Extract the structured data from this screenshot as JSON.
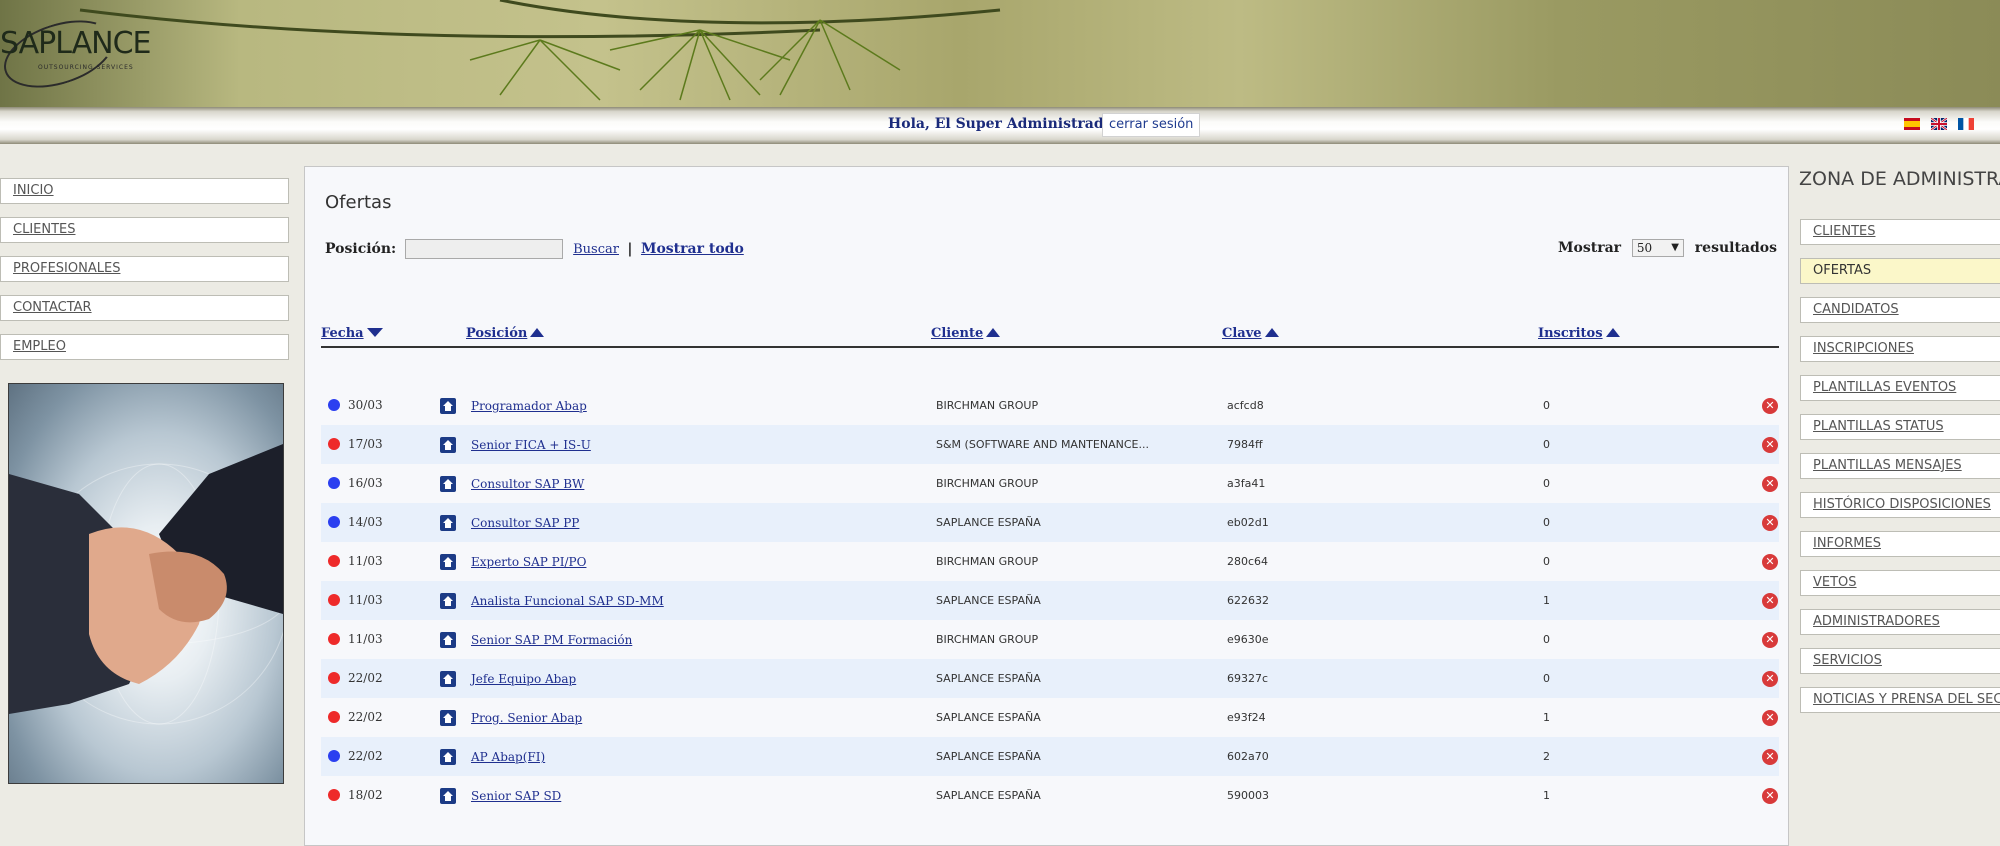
{
  "header": {
    "logo_text": "SAPLANCE",
    "logo_sub": "OUTSOURCING SERVICES"
  },
  "topbar": {
    "greeting": "Hola, El Super Administrador",
    "logout": "cerrar sesión",
    "flags": [
      "es-flag-icon",
      "uk-flag-icon",
      "fr-flag-icon"
    ]
  },
  "leftnav": {
    "items": [
      "INICIO",
      "CLIENTES",
      "PROFESIONALES",
      "CONTACTAR",
      "EMPLEO"
    ]
  },
  "main": {
    "title": "Ofertas",
    "search_label": "Posición:",
    "search_value": "",
    "search_button": "Buscar",
    "separator": "|",
    "show_all": "Mostrar todo",
    "show_label": "Mostrar",
    "show_value": "50",
    "show_suffix": "resultados",
    "columns": {
      "fecha": "Fecha",
      "posicion": "Posición",
      "cliente": "Cliente",
      "clave": "Clave",
      "inscritos": "Inscritos"
    },
    "rows": [
      {
        "status": "blue",
        "fecha": "30/03",
        "posicion": "Programador Abap",
        "cliente": "BIRCHMAN GROUP",
        "clave": "acfcd8",
        "inscritos": "0"
      },
      {
        "status": "red",
        "fecha": "17/03",
        "posicion": "Senior FICA + IS-U",
        "cliente": "S&M (SOFTWARE AND MANTENANCE...",
        "clave": "7984ff",
        "inscritos": "0"
      },
      {
        "status": "blue",
        "fecha": "16/03",
        "posicion": "Consultor SAP BW",
        "cliente": "BIRCHMAN GROUP",
        "clave": "a3fa41",
        "inscritos": "0"
      },
      {
        "status": "blue",
        "fecha": "14/03",
        "posicion": "Consultor SAP PP",
        "cliente": "SAPLANCE ESPAÑA",
        "clave": "eb02d1",
        "inscritos": "0"
      },
      {
        "status": "red",
        "fecha": "11/03",
        "posicion": "Experto SAP PI/PO",
        "cliente": "BIRCHMAN GROUP",
        "clave": "280c64",
        "inscritos": "0"
      },
      {
        "status": "red",
        "fecha": "11/03",
        "posicion": "Analista Funcional SAP SD-MM",
        "cliente": "SAPLANCE ESPAÑA",
        "clave": "622632",
        "inscritos": "1"
      },
      {
        "status": "red",
        "fecha": "11/03",
        "posicion": "Senior SAP PM Formación",
        "cliente": "BIRCHMAN GROUP",
        "clave": "e9630e",
        "inscritos": "0"
      },
      {
        "status": "red",
        "fecha": "22/02",
        "posicion": "Jefe Equipo Abap",
        "cliente": "SAPLANCE ESPAÑA",
        "clave": "69327c",
        "inscritos": "0"
      },
      {
        "status": "red",
        "fecha": "22/02",
        "posicion": "Prog. Senior Abap",
        "cliente": "SAPLANCE ESPAÑA",
        "clave": "e93f24",
        "inscritos": "1"
      },
      {
        "status": "blue",
        "fecha": "22/02",
        "posicion": "AP Abap(FI)",
        "cliente": "SAPLANCE ESPAÑA",
        "clave": "602a70",
        "inscritos": "2"
      },
      {
        "status": "red",
        "fecha": "18/02",
        "posicion": "Senior SAP SD",
        "cliente": "SAPLANCE ESPAÑA",
        "clave": "590003",
        "inscritos": "1"
      }
    ]
  },
  "admin": {
    "title": "ZONA DE ADMINISTRA",
    "items": [
      "CLIENTES",
      "OFERTAS",
      "CANDIDATOS",
      "INSCRIPCIONES",
      "PLANTILLAS EVENTOS",
      "PLANTILLAS STATUS",
      "PLANTILLAS MENSAJES",
      "HISTÓRICO DISPOSICIONES",
      "INFORMES",
      "VETOS",
      "ADMINISTRADORES",
      "SERVICIOS",
      "NOTICIAS Y PRENSA DEL SECT"
    ],
    "active_index": 1
  },
  "colors": {
    "link": "#1f2f8f",
    "status_blue": "#2b3ff0",
    "status_red": "#ee2a2a",
    "row_alt": "#e8f0fb",
    "delete": "#d83a3a",
    "active_nav": "#fbf7c9"
  }
}
